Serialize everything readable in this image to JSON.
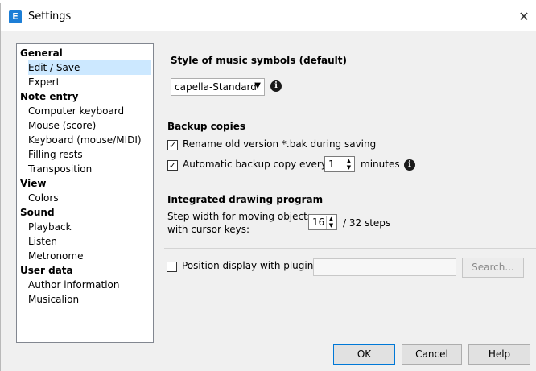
{
  "window": {
    "title": "Settings",
    "app_icon_letter": "E",
    "close_glyph": "✕"
  },
  "tree": {
    "items": [
      {
        "label": "General",
        "type": "category"
      },
      {
        "label": "Edit / Save",
        "type": "sub",
        "selected": true
      },
      {
        "label": "Expert",
        "type": "sub"
      },
      {
        "label": "Note entry",
        "type": "category"
      },
      {
        "label": "Computer keyboard",
        "type": "sub"
      },
      {
        "label": "Mouse (score)",
        "type": "sub"
      },
      {
        "label": "Keyboard (mouse/MIDI)",
        "type": "sub"
      },
      {
        "label": "Filling rests",
        "type": "sub"
      },
      {
        "label": "Transposition",
        "type": "sub"
      },
      {
        "label": "View",
        "type": "category"
      },
      {
        "label": "Colors",
        "type": "sub"
      },
      {
        "label": "Sound",
        "type": "category"
      },
      {
        "label": "Playback",
        "type": "sub"
      },
      {
        "label": "Listen",
        "type": "sub"
      },
      {
        "label": "Metronome",
        "type": "sub"
      },
      {
        "label": "User data",
        "type": "category"
      },
      {
        "label": "Author information",
        "type": "sub"
      },
      {
        "label": "Musicalion",
        "type": "sub"
      }
    ]
  },
  "style": {
    "heading": "Style of music symbols (default)",
    "selected_value": "capella-Standard",
    "arrow": "▼",
    "info": "i"
  },
  "backup": {
    "heading": "Backup copies",
    "rename_label": "Rename old version *.bak during saving",
    "rename_checked": true,
    "auto_label": "Automatic backup copy every",
    "auto_checked": true,
    "auto_value": "1",
    "minutes_label": "minutes",
    "info": "i",
    "check_glyph": "✓"
  },
  "drawing": {
    "heading": "Integrated drawing program",
    "step_label_1": "Step width for moving objects",
    "step_label_2": "with cursor keys:",
    "step_value": "16",
    "steps_suffix": "/ 32 steps"
  },
  "plugin": {
    "label": "Position display with plugin",
    "checked": false,
    "path_value": "",
    "search_label": "Search..."
  },
  "buttons": {
    "ok": "OK",
    "cancel": "Cancel",
    "help": "Help"
  }
}
